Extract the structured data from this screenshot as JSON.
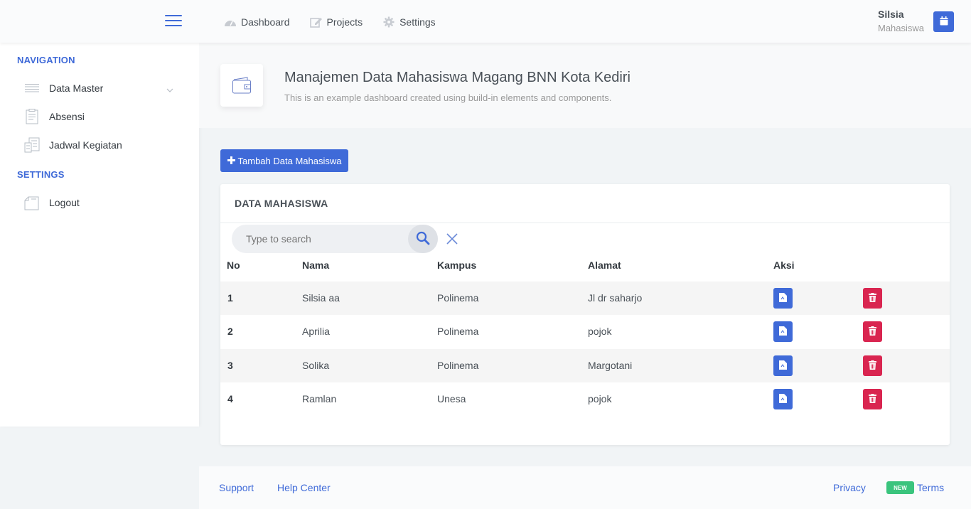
{
  "header": {
    "nav": [
      {
        "label": "Dashboard",
        "icon": "dashboard-icon"
      },
      {
        "label": "Projects",
        "icon": "edit-icon"
      },
      {
        "label": "Settings",
        "icon": "gear-icon"
      }
    ],
    "user": {
      "name": "Silsia",
      "role": "Mahasiswa"
    }
  },
  "sidebar": {
    "navigation_heading": "NAVIGATION",
    "items": [
      {
        "label": "Data Master",
        "icon": "list-icon"
      },
      {
        "label": "Absensi",
        "icon": "clipboard-icon"
      },
      {
        "label": "Jadwal Kegiatan",
        "icon": "schedule-icon"
      }
    ],
    "settings_heading": "SETTINGS",
    "settings_items": [
      {
        "label": "Logout",
        "icon": "logout-icon"
      }
    ]
  },
  "page": {
    "title": "Manajemen Data Mahasiswa Magang BNN Kota Kediri",
    "subtitle": "This is an example dashboard created using build-in elements and components."
  },
  "add_button": {
    "label": "Tambah Data Mahasiswa"
  },
  "card": {
    "title": "DATA MAHASISWA",
    "search_placeholder": "Type to search",
    "columns": [
      "No",
      "Nama",
      "Kampus",
      "Alamat",
      "Aksi"
    ],
    "rows": [
      {
        "no": "1",
        "nama": "Silsia aa",
        "kampus": "Polinema",
        "alamat": "Jl dr saharjo"
      },
      {
        "no": "2",
        "nama": "Aprilia",
        "kampus": "Polinema",
        "alamat": "pojok"
      },
      {
        "no": "3",
        "nama": "Solika",
        "kampus": "Polinema",
        "alamat": "Margotani"
      },
      {
        "no": "4",
        "nama": "Ramlan",
        "kampus": "Unesa",
        "alamat": "pojok"
      }
    ]
  },
  "footer": {
    "support": "Support",
    "help": "Help Center",
    "privacy": "Privacy",
    "badge": "NEW",
    "terms": "Terms"
  },
  "colors": {
    "primary": "#3f6ad8",
    "danger": "#d92550",
    "success": "#3ac47d"
  }
}
